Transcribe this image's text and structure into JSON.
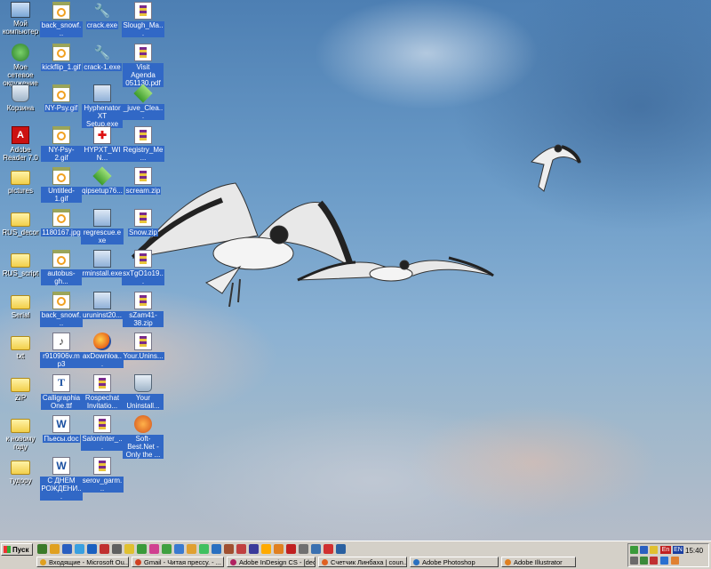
{
  "desktop": {
    "icons": [
      {
        "label": "Мой компьютер",
        "type": "computer",
        "col": 0,
        "row": 0
      },
      {
        "label": "Мое сетевое окружение",
        "type": "network",
        "col": 0,
        "row": 1
      },
      {
        "label": "Корзина",
        "type": "recycle",
        "col": 0,
        "row": 2
      },
      {
        "label": "Adobe Reader 7.0",
        "type": "pdf",
        "col": 0,
        "row": 3
      },
      {
        "label": "pictures",
        "type": "folder",
        "col": 0,
        "row": 4
      },
      {
        "label": "RUS_decor",
        "type": "folder",
        "col": 0,
        "row": 5
      },
      {
        "label": "RUS_script",
        "type": "folder",
        "col": 0,
        "row": 6
      },
      {
        "label": "Serial",
        "type": "folder",
        "col": 0,
        "row": 7
      },
      {
        "label": "txt",
        "type": "folder",
        "col": 0,
        "row": 8
      },
      {
        "label": "ZIP",
        "type": "folder",
        "col": 0,
        "row": 9
      },
      {
        "label": "к новому году",
        "type": "folder",
        "col": 0,
        "row": 10
      },
      {
        "label": "тудору",
        "type": "folder",
        "col": 0,
        "row": 11
      },
      {
        "label": "back_snowf...",
        "type": "gif",
        "col": 1,
        "row": 0
      },
      {
        "label": "kickflip_1.gif",
        "type": "gif",
        "col": 1,
        "row": 1
      },
      {
        "label": "NY-Psy.gif",
        "type": "gif",
        "col": 1,
        "row": 2
      },
      {
        "label": "NY-Psy-2.gif",
        "type": "gif",
        "col": 1,
        "row": 3
      },
      {
        "label": "Untitled-1.gif",
        "type": "gif",
        "col": 1,
        "row": 4
      },
      {
        "label": "1180167.jpg",
        "type": "gif",
        "col": 1,
        "row": 5
      },
      {
        "label": "autobus-gh...",
        "type": "gif",
        "col": 1,
        "row": 6
      },
      {
        "label": "back_snowf...",
        "type": "gif",
        "col": 1,
        "row": 7
      },
      {
        "label": "r910906v.mp3",
        "type": "mp3",
        "col": 1,
        "row": 8
      },
      {
        "label": "Calligraphia One.ttf",
        "type": "font",
        "col": 1,
        "row": 9
      },
      {
        "label": "Пьесы.doc",
        "type": "doc",
        "col": 1,
        "row": 10
      },
      {
        "label": "С ДНЕМ РОЖДЕНИ...",
        "type": "doc",
        "col": 1,
        "row": 11
      },
      {
        "label": "crack.exe",
        "type": "exe",
        "col": 2,
        "row": 0
      },
      {
        "label": "crack-1.exe",
        "type": "exe",
        "col": 2,
        "row": 1
      },
      {
        "label": "Hyphenator XT Setup.exe",
        "type": "setup",
        "col": 2,
        "row": 2
      },
      {
        "label": "HYPXT_WIN...",
        "type": "reg",
        "col": 2,
        "row": 3
      },
      {
        "label": "qipsetup76...",
        "type": "green",
        "col": 2,
        "row": 4
      },
      {
        "label": "regrescue.exe",
        "type": "setup",
        "col": 2,
        "row": 5
      },
      {
        "label": "rminstall.exe",
        "type": "setup",
        "col": 2,
        "row": 6
      },
      {
        "label": "uruninst20...",
        "type": "setup",
        "col": 2,
        "row": 7
      },
      {
        "label": "axDownloa...",
        "type": "firefox",
        "col": 2,
        "row": 8
      },
      {
        "label": "Rospechat Invitatio...",
        "type": "zip",
        "col": 2,
        "row": 9
      },
      {
        "label": "SalonInter_...",
        "type": "zip",
        "col": 2,
        "row": 10
      },
      {
        "label": "serov_garm...",
        "type": "zip",
        "col": 2,
        "row": 11
      },
      {
        "label": "Slough_Ma...",
        "type": "zip",
        "col": 3,
        "row": 0
      },
      {
        "label": "Visit Agenda 051130.pdf",
        "type": "zip",
        "col": 3,
        "row": 1
      },
      {
        "label": "_juve_Clea...",
        "type": "green",
        "col": 3,
        "row": 2
      },
      {
        "label": "Registry_Me...",
        "type": "zip",
        "col": 3,
        "row": 3
      },
      {
        "label": "scream.zip",
        "type": "zip",
        "col": 3,
        "row": 4
      },
      {
        "label": "Snow.zip",
        "type": "zip",
        "col": 3,
        "row": 5
      },
      {
        "label": "sxTgO1o19...",
        "type": "zip",
        "col": 3,
        "row": 6
      },
      {
        "label": "sZam41-38.zip",
        "type": "zip",
        "col": 3,
        "row": 7
      },
      {
        "label": "Your.Unins...",
        "type": "zip",
        "col": 3,
        "row": 8
      },
      {
        "label": "Your Uninstall...",
        "type": "trash",
        "col": 3,
        "row": 9
      },
      {
        "label": "Soft-Best.Net - Only the ...",
        "type": "sbn",
        "col": 3,
        "row": 10
      }
    ]
  },
  "taskbar": {
    "start_label": "Пуск",
    "quick_launch_colors": [
      "#3a7a2a",
      "#e0a020",
      "#2a5fc0",
      "#3aa0e0",
      "#1a60c0",
      "#c03030",
      "#606060",
      "#e0c030",
      "#3a9a3a",
      "#d04090",
      "#40a040",
      "#3a7ad0",
      "#e0a030",
      "#40c060",
      "#2a70c0",
      "#a05030",
      "#c04040",
      "#3a3a9a",
      "#ffaa00",
      "#e08020",
      "#c02020",
      "#707070",
      "#3a70b0",
      "#d03030",
      "#2a60a0"
    ],
    "tasks": [
      {
        "label": "Входящие - Microsoft Ou...",
        "color": "#e0a020"
      },
      {
        "label": "Gmail - Читая прессу. - ...",
        "color": "#d04020"
      },
      {
        "label": "Adobe InDesign CS - [dec...",
        "color": "#b02060"
      },
      {
        "label": "Счетчик Линбаха | coun...",
        "color": "#e06020"
      },
      {
        "label": "Adobe Photoshop",
        "color": "#2a70c0"
      },
      {
        "label": "Adobe Illustrator",
        "color": "#e08020"
      }
    ],
    "tray": {
      "lang_active": "En",
      "lang_other": "EN",
      "time": "15:40"
    }
  }
}
